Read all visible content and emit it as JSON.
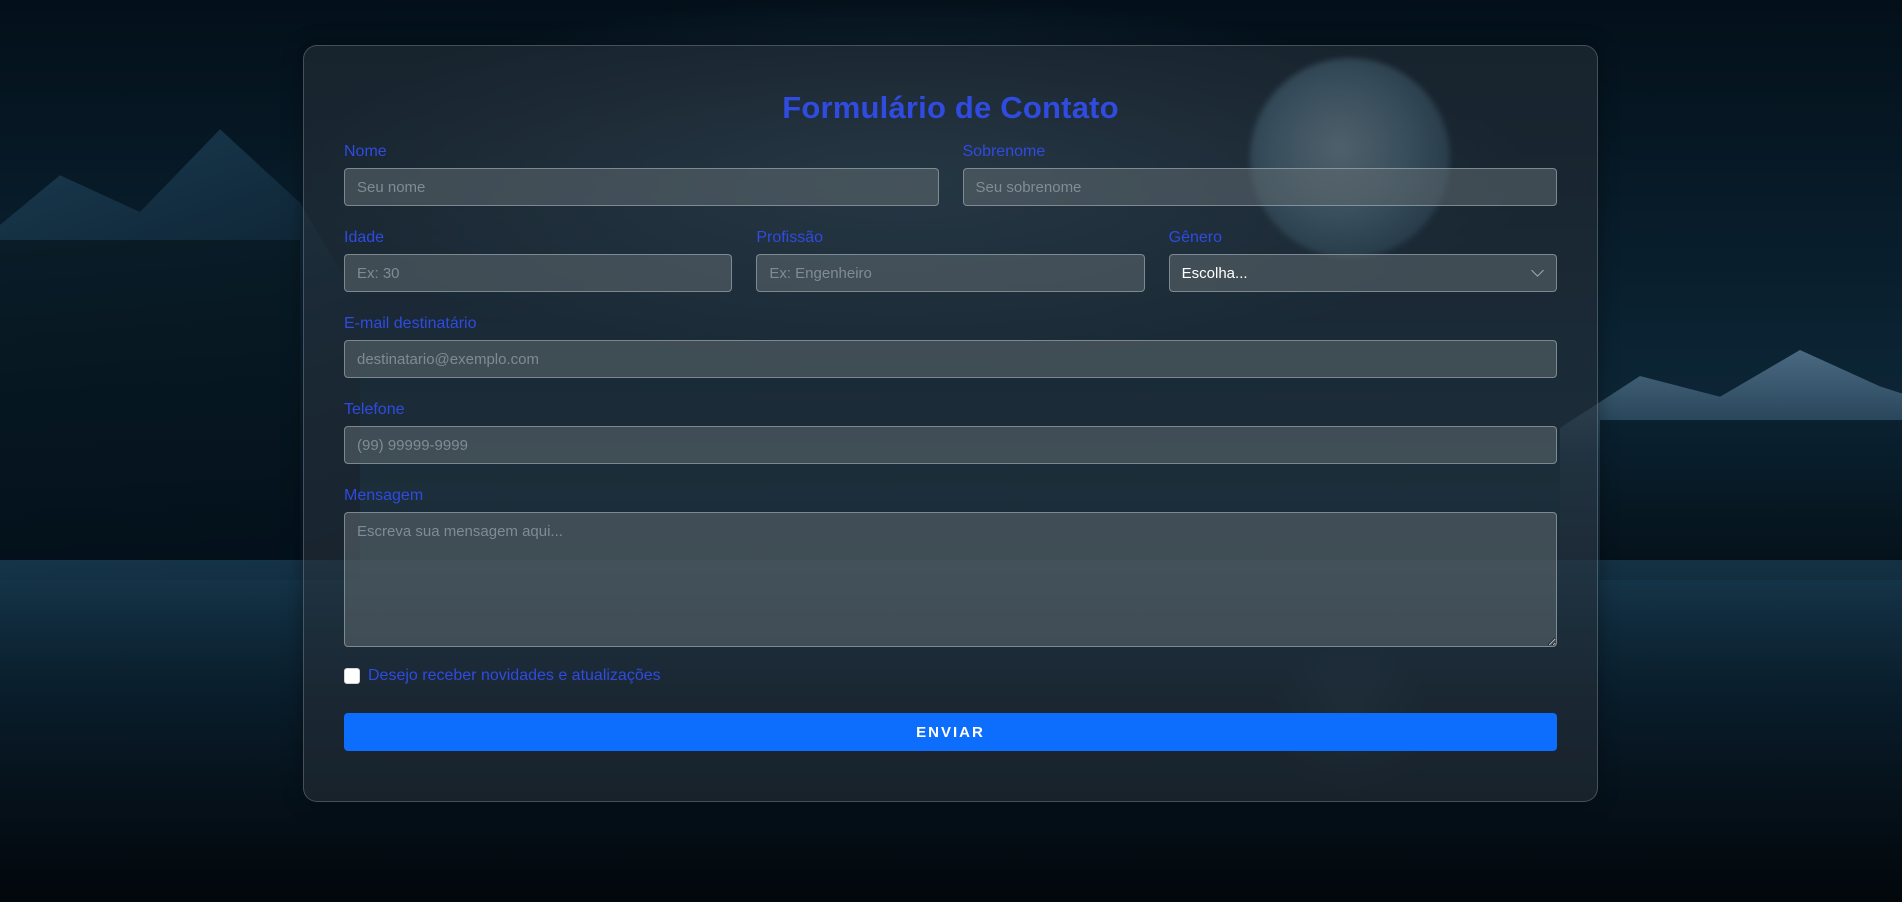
{
  "form": {
    "title": "Formulário de Contato",
    "first_name": {
      "label": "Nome",
      "placeholder": "Seu nome"
    },
    "last_name": {
      "label": "Sobrenome",
      "placeholder": "Seu sobrenome"
    },
    "age": {
      "label": "Idade",
      "placeholder": "Ex: 30"
    },
    "profession": {
      "label": "Profissão",
      "placeholder": "Ex: Engenheiro"
    },
    "gender": {
      "label": "Gênero",
      "selected": "Escolha..."
    },
    "email": {
      "label": "E-mail destinatário",
      "placeholder": "destinatario@exemplo.com"
    },
    "phone": {
      "label": "Telefone",
      "placeholder": "(99) 99999-9999"
    },
    "message": {
      "label": "Mensagem",
      "placeholder": "Escreva sua mensagem aqui..."
    },
    "newsletter": {
      "label": "Desejo receber novidades e atualizações",
      "checked": false
    },
    "submit_label": "ENVIAR"
  },
  "colors": {
    "accent_text": "#2f4be0",
    "button": "#0d6efd"
  },
  "icons": {
    "select_arrow": "chevron-down-icon"
  }
}
